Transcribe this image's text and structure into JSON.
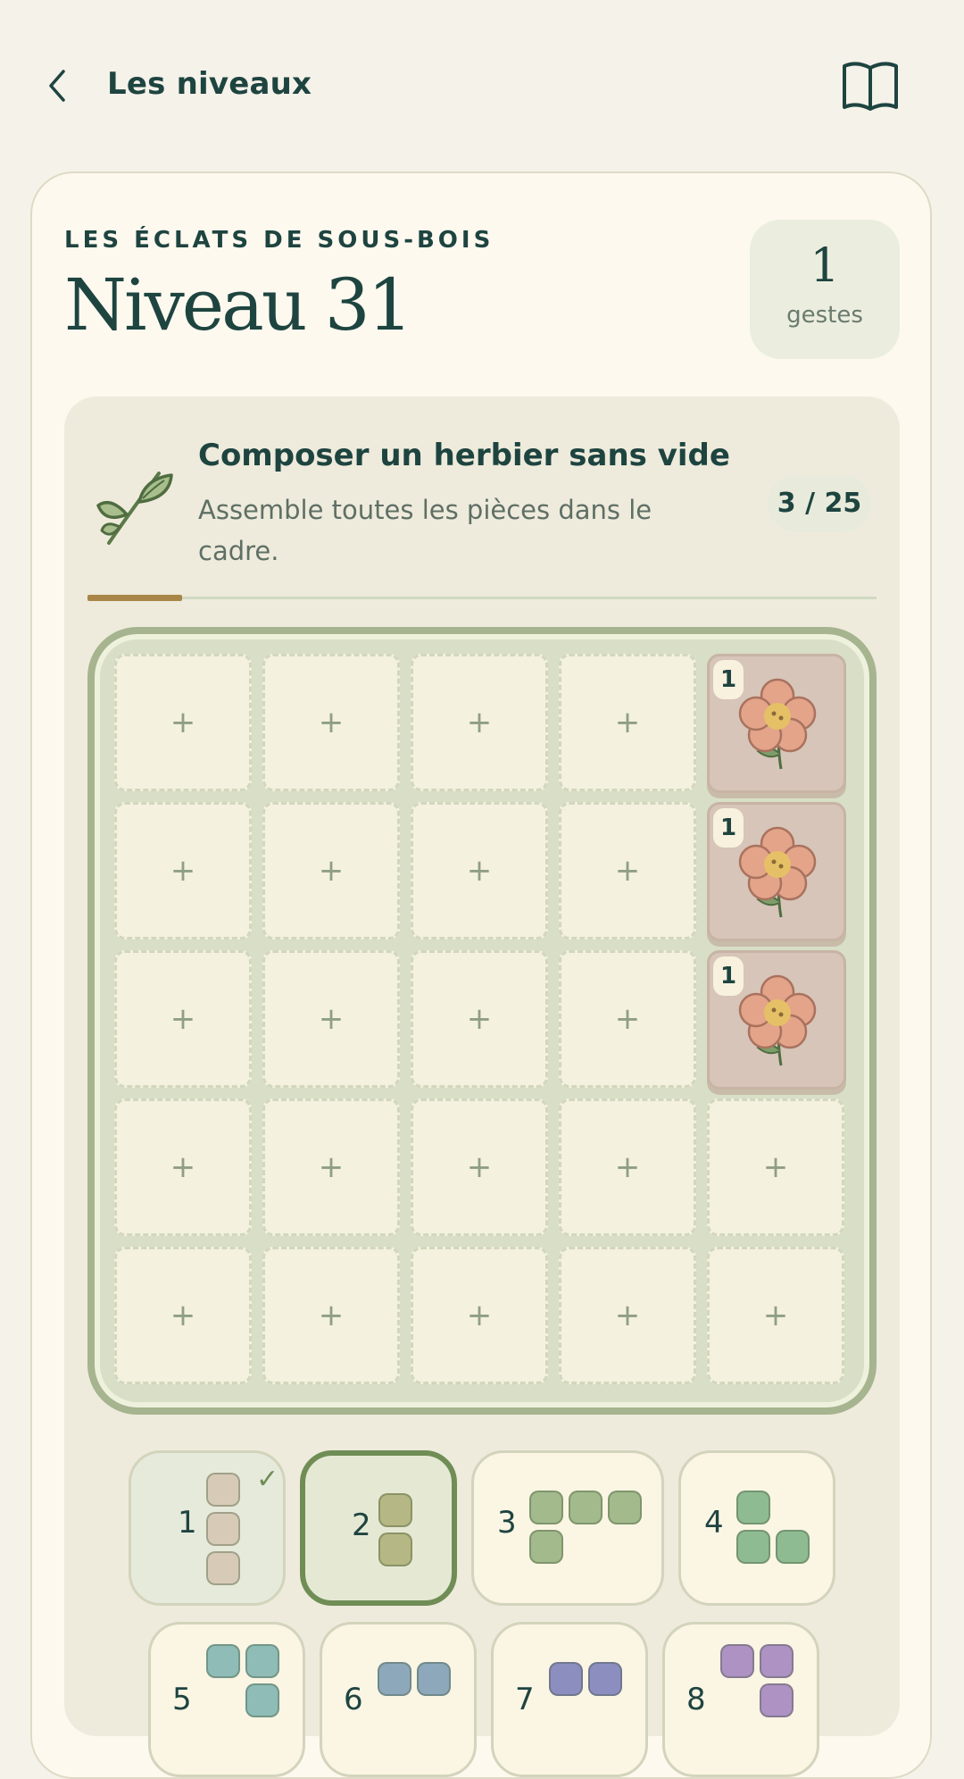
{
  "header": {
    "back_label": "Les niveaux"
  },
  "level": {
    "collection": "LES ÉCLATS DE SOUS-BOIS",
    "title": "Niveau 31",
    "moves_value": "1",
    "moves_label": "gestes"
  },
  "goal": {
    "title": "Composer un herbier sans vide",
    "description": "Assemble toutes les pièces dans le cadre.",
    "count": "3 / 25",
    "progress_fraction": 0.12
  },
  "board": {
    "rows": 5,
    "cols": 5,
    "empty_symbol": "+",
    "placed_tiles": [
      {
        "row": 0,
        "col": 4,
        "badge": "1",
        "icon": "flower-icon"
      },
      {
        "row": 1,
        "col": 4,
        "badge": "1",
        "icon": "flower-icon"
      },
      {
        "row": 2,
        "col": 4,
        "badge": "1",
        "icon": "flower-icon"
      }
    ]
  },
  "pieces": [
    {
      "number": "1",
      "state": "done",
      "check": "✓",
      "color": "#d7cbb8"
    },
    {
      "number": "2",
      "state": "selected",
      "color": "#b5b784"
    },
    {
      "number": "3",
      "state": "default",
      "color": "#a3ba8d"
    },
    {
      "number": "4",
      "state": "default",
      "color": "#8fbb92"
    },
    {
      "number": "5",
      "state": "default",
      "color": "#8fbcb6"
    },
    {
      "number": "6",
      "state": "default",
      "color": "#8ea8bb"
    },
    {
      "number": "7",
      "state": "default",
      "color": "#8d8ec0"
    },
    {
      "number": "8",
      "state": "default",
      "color": "#ad92c3"
    }
  ],
  "colors": {
    "accent_green": "#6f8d55",
    "progress": "#a98548",
    "text_dark": "#1e4440"
  }
}
